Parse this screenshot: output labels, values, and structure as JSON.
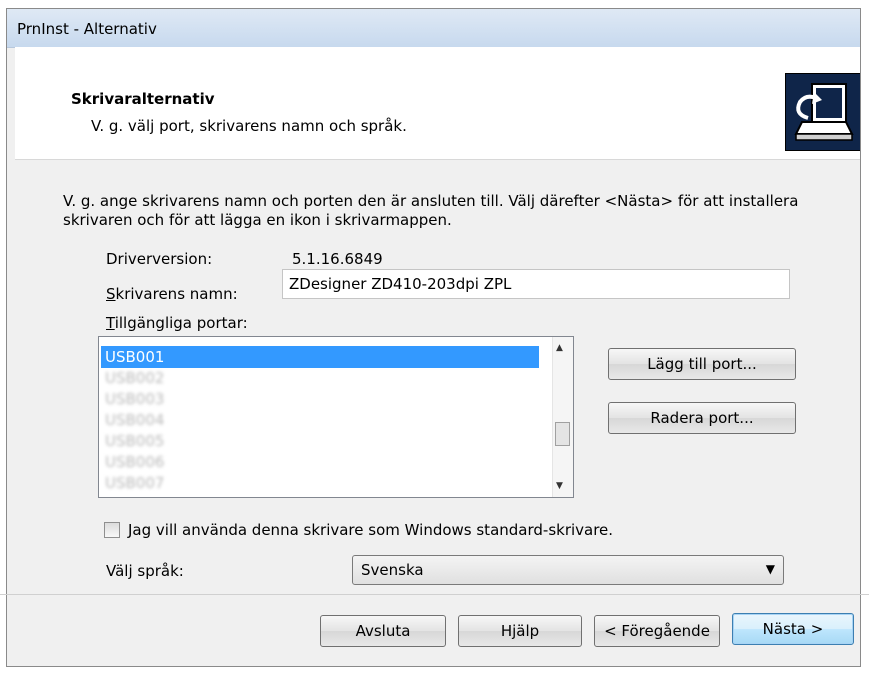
{
  "window": {
    "title": "PrnInst - Alternativ"
  },
  "header": {
    "title": "Skrivaralternativ",
    "subtitle": "V. g. välj port, skrivarens namn och språk.",
    "logo_icon": "printer-install-icon"
  },
  "intro_text": "V. g. ange skrivarens namn och porten den är ansluten till. Välj därefter <Nästa> för att installera skrivaren och för att lägga en ikon i skrivarmappen.",
  "driver": {
    "label": "Driverversion:",
    "value": "5.1.16.6849"
  },
  "printer_name": {
    "label_prefix": "S",
    "label_rest": "krivarens namn:",
    "value": "ZDesigner ZD410-203dpi ZPL"
  },
  "ports": {
    "label_prefix": "T",
    "label_rest": "illgängliga portar:",
    "items": [
      "USB001",
      "USB002",
      "USB003",
      "USB004",
      "USB005",
      "USB006",
      "USB007"
    ],
    "selected": "USB001"
  },
  "buttons": {
    "add_port": "Lägg till port...",
    "delete_port": "Radera port...",
    "cancel": "Avsluta",
    "help": "Hjälp",
    "back": "< Föregående",
    "next": "Nästa >"
  },
  "default_checkbox": {
    "label": "Jag vill använda denna skrivare som Windows standard-skrivare.",
    "checked": false
  },
  "language": {
    "label": "Välj språk:",
    "value": "Svenska"
  },
  "colors": {
    "selection": "#3399ff",
    "logo_bg": "#0f2549",
    "titlebar": "#c7d9ee"
  }
}
